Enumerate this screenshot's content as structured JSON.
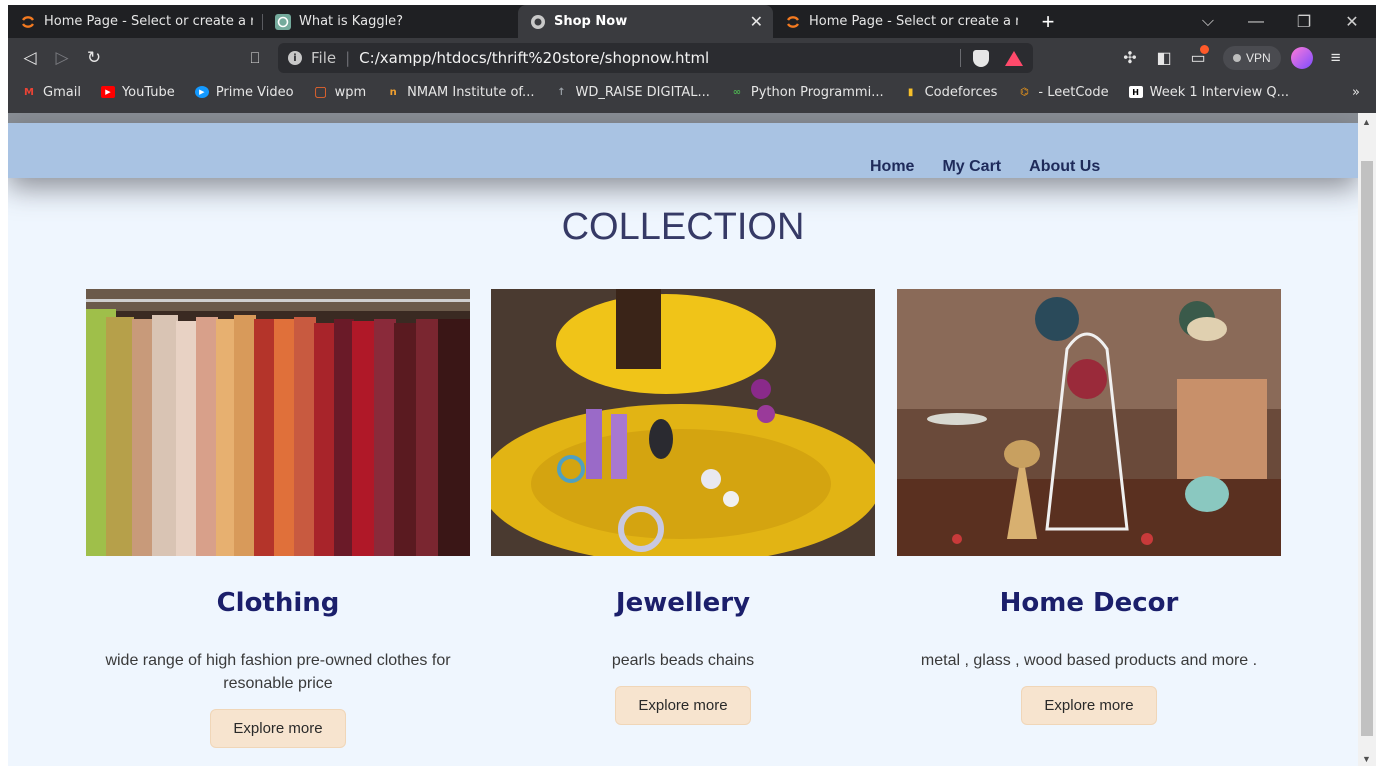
{
  "browser": {
    "tabs": [
      {
        "title": "Home Page - Select or create a notebo",
        "icon": "circle-logo-icon",
        "active": false
      },
      {
        "title": "What is Kaggle?",
        "icon": "chatgpt-icon",
        "active": false
      },
      {
        "title": "Shop Now",
        "icon": "globe-icon",
        "active": true,
        "close": "✕"
      },
      {
        "title": "Home Page - Select or create a notebo",
        "icon": "circle-logo-icon",
        "active": false
      }
    ],
    "new_tab": "+",
    "window_controls": {
      "dropdown": "⌵",
      "minimize": "—",
      "restore": "❐",
      "close": "✕"
    },
    "nav": {
      "back": "◁",
      "forward": "▷",
      "reload": "↻",
      "bookmark": "⎕"
    },
    "address": {
      "scheme": "File",
      "separator": "|",
      "url": "C:/xampp/htdocs/thrift%20store/shopnow.html",
      "info": "i"
    },
    "vpn_label": "VPN",
    "menu": "≡",
    "bookmarks": [
      {
        "label": "Gmail",
        "icon": "gmail-icon",
        "color": "#ea4335",
        "glyph": "M"
      },
      {
        "label": "YouTube",
        "icon": "youtube-icon",
        "color": "#ff0000",
        "glyph": "▶"
      },
      {
        "label": "Prime Video",
        "icon": "prime-video-icon",
        "color": "#1399ff",
        "glyph": "▶"
      },
      {
        "label": "wpm",
        "icon": "wpm-icon",
        "color": "#ff6a2a",
        "glyph": "▢"
      },
      {
        "label": "NMAM Institute of...",
        "icon": "nmam-icon",
        "color": "#f0a030",
        "glyph": "n"
      },
      {
        "label": "WD_RAISE DIGITAL...",
        "icon": "wd-raise-icon",
        "color": "#9aa0a6",
        "glyph": "↑"
      },
      {
        "label": "Python Programmi...",
        "icon": "python-icon",
        "color": "#4caf50",
        "glyph": "∞"
      },
      {
        "label": "Codeforces",
        "icon": "codeforces-icon",
        "color": "#f7c02a",
        "glyph": "▮"
      },
      {
        "label": "- LeetCode",
        "icon": "leetcode-icon",
        "color": "#ffa116",
        "glyph": "⌬"
      },
      {
        "label": "Week 1 Interview Q...",
        "icon": "week-icon",
        "color": "#ffffff",
        "glyph": "H"
      }
    ],
    "bookmarks_more": "»"
  },
  "site": {
    "nav": {
      "home": "Home",
      "cart": "My Cart",
      "about": "About Us"
    },
    "collection_title": "COLLECTION",
    "cards": [
      {
        "title": "Clothing",
        "description": "wide range of high fashion pre-owned clothes for resonable price",
        "button": "Explore more",
        "image": "clothing-rack-image"
      },
      {
        "title": "Jewellery",
        "description": "pearls beads chains",
        "button": "Explore more",
        "image": "jewellery-stand-image"
      },
      {
        "title": "Home Decor",
        "description": "metal , glass , wood based products and more .",
        "button": "Explore more",
        "image": "home-decor-image"
      }
    ]
  },
  "colors": {
    "page_bg": "#eff6fe",
    "navbar": "#a9c3e3",
    "heading": "#1b1f6b",
    "button_bg": "#f7e4cf"
  }
}
